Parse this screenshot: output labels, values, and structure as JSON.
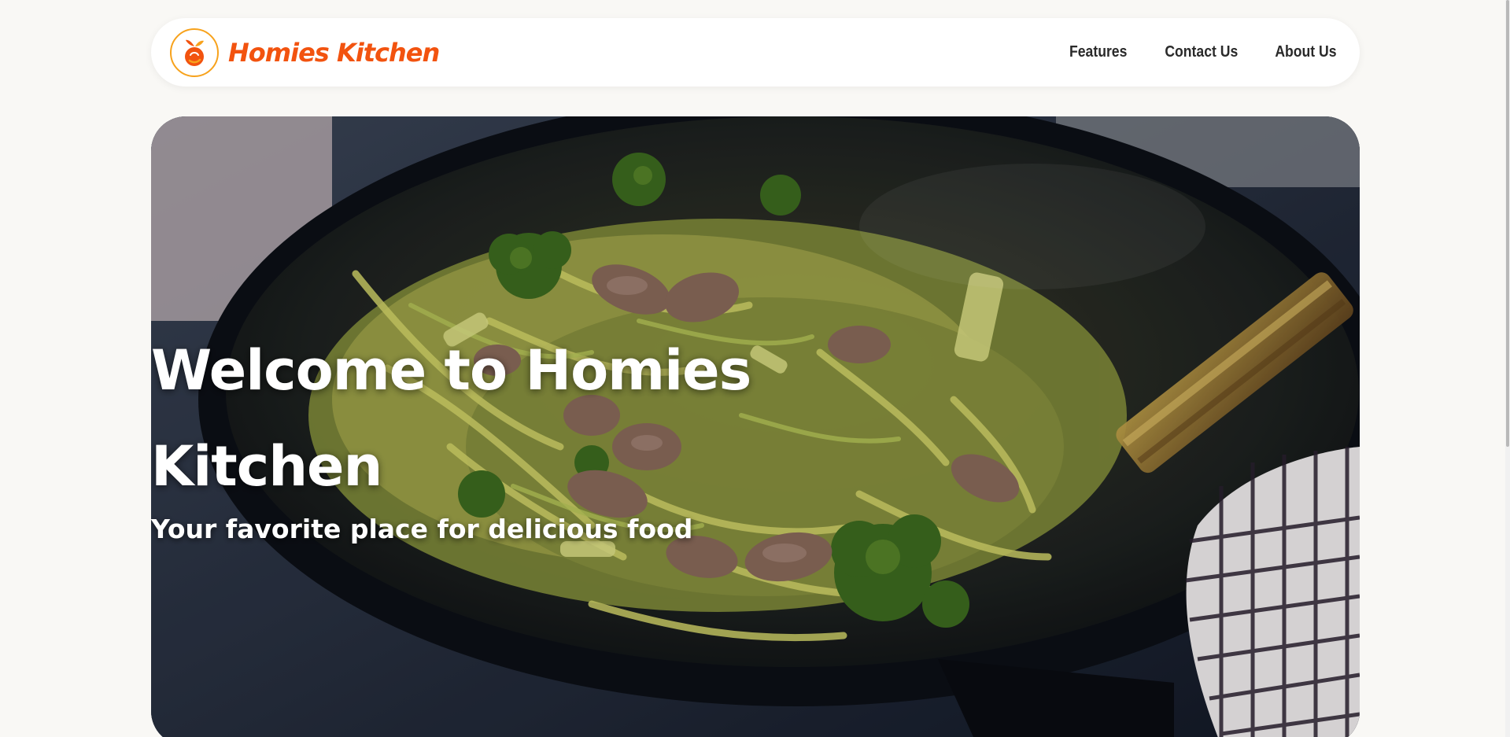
{
  "brand": {
    "name": "Homies Kitchen",
    "logo_icon": "peach-fruit-icon",
    "colors": {
      "brand": "#f2530f",
      "logo_ring": "#f7a21c"
    }
  },
  "nav": {
    "items": [
      {
        "label": "Features"
      },
      {
        "label": "Contact Us"
      },
      {
        "label": "About Us"
      }
    ]
  },
  "hero": {
    "title_line1": "Welcome to Homies",
    "title_line2": "Kitchen",
    "subtitle": "Your favorite place for delicious food",
    "background_icon": "stir-fry-wok-image"
  },
  "colors": {
    "page_bg": "#f9f8f5",
    "nav_text": "#2a2a2a",
    "hero_text": "#ffffff"
  }
}
